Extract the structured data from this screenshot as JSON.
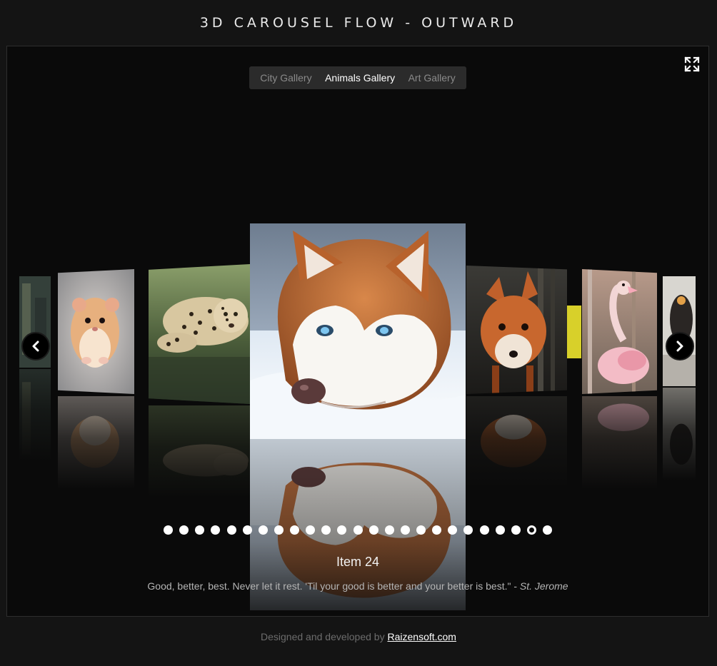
{
  "header": {
    "title": "3D CAROUSEL FLOW - OUTWARD"
  },
  "toolbar": {
    "fullscreen_icon": "fullscreen-expand-icon"
  },
  "tabs": [
    {
      "label": "City Gallery",
      "active": false
    },
    {
      "label": "Animals Gallery",
      "active": true
    },
    {
      "label": "Art Gallery",
      "active": false
    }
  ],
  "carousel": {
    "slides": [
      {
        "subject": "hamster",
        "position": "far-left"
      },
      {
        "subject": "leopard",
        "position": "left"
      },
      {
        "subject": "husky",
        "position": "center"
      },
      {
        "subject": "fox",
        "position": "right"
      },
      {
        "subject": "flamingo",
        "position": "far-right"
      }
    ],
    "prev_icon": "chevron-left-icon",
    "next_icon": "chevron-right-icon"
  },
  "pagination": {
    "total": 25,
    "active_index": 23
  },
  "caption": {
    "title": "Item 24",
    "quote": "Good, better, best. Never let it rest. 'Til your good is better and your better is best.\" - ",
    "author": "St. Jerome"
  },
  "footer": {
    "text": "Designed and developed by ",
    "link_text": "Raizensoft.com"
  },
  "colors": {
    "background": "#141414",
    "stage": "#0a0a0a",
    "tab_bar": "#2b2b2b",
    "active_tab": "#ffffff",
    "inactive_tab": "#8a8a8a"
  }
}
